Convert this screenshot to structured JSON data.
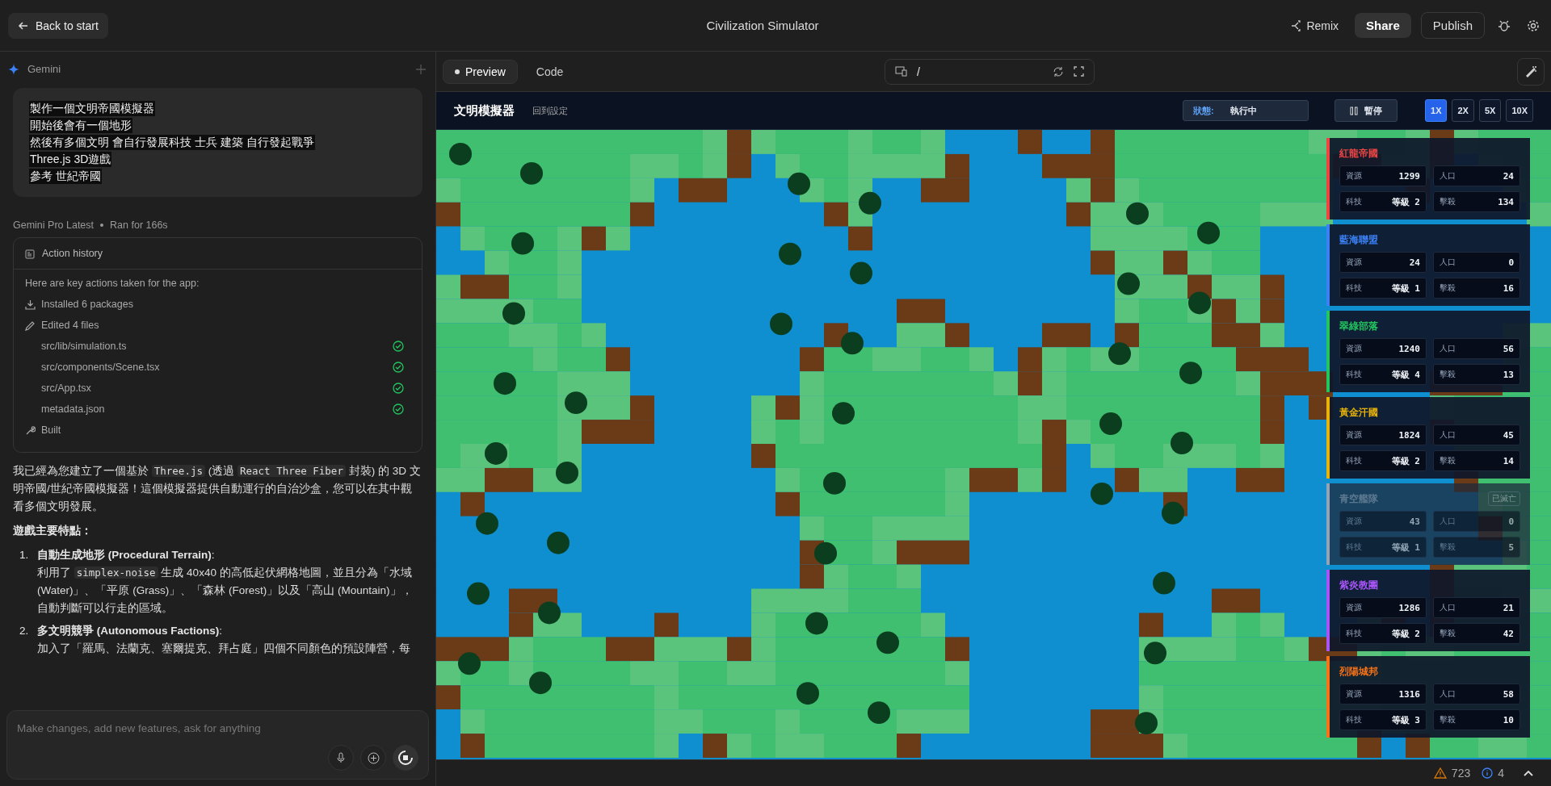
{
  "top_bar": {
    "back_button": "Back to start",
    "title": "Civilization Simulator",
    "remix": "Remix",
    "share": "Share",
    "publish": "Publish"
  },
  "chat": {
    "header": "Gemini",
    "prompt_lines": [
      "製作一個文明帝國模擬器",
      "開始後會有一個地形",
      "然後有多個文明 會自行發展科技 士兵 建築 自行發起戰爭",
      "Three.js 3D遊戲",
      "參考 世紀帝國"
    ],
    "meta": {
      "model": "Gemini Pro Latest",
      "run": "Ran for 166s"
    },
    "action_history": {
      "title": "Action history",
      "intro": "Here are key actions taken for the app:",
      "steps": [
        {
          "kind": "install",
          "label": "Installed 6 packages"
        },
        {
          "kind": "edit",
          "label": "Edited 4 files",
          "files": [
            {
              "name": "src/lib/simulation.ts",
              "done": true
            },
            {
              "name": "src/components/Scene.tsx",
              "done": true
            },
            {
              "name": "src/App.tsx",
              "done": true
            },
            {
              "name": "metadata.json",
              "done": true
            }
          ]
        },
        {
          "kind": "build",
          "label": "Built"
        }
      ]
    },
    "response": [
      {
        "kind": "text",
        "text": "我已經為您建立了一個基於 "
      },
      {
        "kind": "code",
        "text": "Three.js"
      },
      {
        "kind": "text",
        "text": " (透過 "
      },
      {
        "kind": "code",
        "text": "React Three Fiber"
      },
      {
        "kind": "text",
        "text": " 封裝) 的 3D 文明帝國/世紀帝國模擬器！這個模擬器提供自動運行的自治沙盒，您可以在其中觀看多個文明發展。"
      }
    ],
    "heading": "遊戲主要特點：",
    "features": [
      {
        "number": "1.",
        "title": "**自動生成地形 (Procedural Terrain)**:",
        "body": [
          {
            "kind": "text",
            "text": "利用了 "
          },
          {
            "kind": "code",
            "text": "simplex-noise"
          },
          {
            "kind": "text",
            "text": " 生成 40x40 的高低起伏網格地圖，並且分為「水域 (Water)」、「平原 (Grass)」、「森林 (Forest)」以及「高山 (Mountain)」，自動判斷可以行走的區域。"
          }
        ]
      },
      {
        "number": "2.",
        "title": "**多文明競爭 (Autonomous Factions)**:",
        "body": [
          {
            "kind": "text",
            "text": "加入了「羅馬、法蘭克、塞爾提克、拜占庭」四個不同顏色的預設陣營，每"
          }
        ]
      }
    ],
    "input": {
      "placeholder": "Make changes, add new features, ask for anything"
    }
  },
  "preview": {
    "tabs": [
      {
        "label": "Preview",
        "selected": true
      },
      {
        "label": "Code",
        "selected": false
      }
    ],
    "address": "/"
  },
  "app": {
    "title": "文明模擬器",
    "reset": "回到設定",
    "status_label": "狀態:",
    "status_value": "執行中",
    "pause": "暫停",
    "speeds": [
      {
        "label": "1X",
        "selected": true
      },
      {
        "label": "2X",
        "selected": false
      },
      {
        "label": "5X",
        "selected": false
      },
      {
        "label": "10X",
        "selected": false
      }
    ],
    "factions": [
      {
        "name": "紅龍帝國",
        "color": "#ef4444",
        "destroyed": false,
        "stats": [
          {
            "label": "資源",
            "value": "1299"
          },
          {
            "label": "人口",
            "value": "24"
          },
          {
            "label": "科技",
            "value": "等級 2"
          },
          {
            "label": "擊殺",
            "value": "134"
          }
        ]
      },
      {
        "name": "藍海聯盟",
        "color": "#3b82f6",
        "destroyed": false,
        "stats": [
          {
            "label": "資源",
            "value": "24"
          },
          {
            "label": "人口",
            "value": "0"
          },
          {
            "label": "科技",
            "value": "等級 1"
          },
          {
            "label": "擊殺",
            "value": "16"
          }
        ]
      },
      {
        "name": "翠綠部落",
        "color": "#22c55e",
        "destroyed": false,
        "stats": [
          {
            "label": "資源",
            "value": "1240"
          },
          {
            "label": "人口",
            "value": "56"
          },
          {
            "label": "科技",
            "value": "等級 4"
          },
          {
            "label": "擊殺",
            "value": "13"
          }
        ]
      },
      {
        "name": "黃金汗國",
        "color": "#eab308",
        "destroyed": false,
        "stats": [
          {
            "label": "資源",
            "value": "1824"
          },
          {
            "label": "人口",
            "value": "45"
          },
          {
            "label": "科技",
            "value": "等級 2"
          },
          {
            "label": "擊殺",
            "value": "14"
          }
        ]
      },
      {
        "name": "青空艦隊",
        "color": "#94a3b8",
        "destroyed": true,
        "badge": "已滅亡",
        "stats": [
          {
            "label": "資源",
            "value": "43"
          },
          {
            "label": "人口",
            "value": "0"
          },
          {
            "label": "科技",
            "value": "等級 1"
          },
          {
            "label": "擊殺",
            "value": "5"
          }
        ]
      },
      {
        "name": "紫炎教團",
        "color": "#a855f7",
        "destroyed": false,
        "stats": [
          {
            "label": "資源",
            "value": "1286"
          },
          {
            "label": "人口",
            "value": "21"
          },
          {
            "label": "科技",
            "value": "等級 2"
          },
          {
            "label": "擊殺",
            "value": "42"
          }
        ]
      },
      {
        "name": "烈陽城邦",
        "color": "#f97316",
        "destroyed": false,
        "stats": [
          {
            "label": "資源",
            "value": "1316"
          },
          {
            "label": "人口",
            "value": "58"
          },
          {
            "label": "科技",
            "value": "等級 3"
          },
          {
            "label": "擊殺",
            "value": "10"
          }
        ]
      }
    ]
  },
  "status_bar": {
    "warnings": "723",
    "info": "4"
  }
}
